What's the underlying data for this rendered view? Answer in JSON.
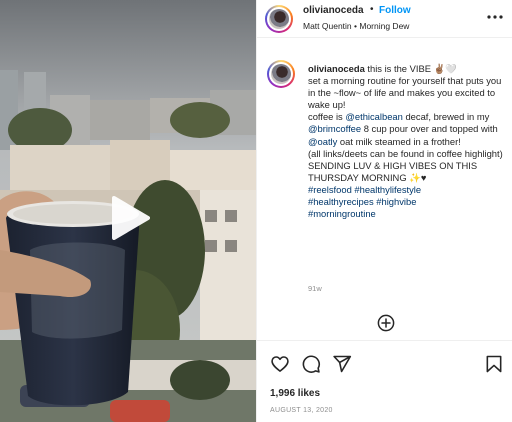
{
  "post": {
    "username": "olivianoceda",
    "separator": "•",
    "follow_label": "Follow",
    "subtitle": "Matt Quentin • Morning Dew",
    "more_icon": "more-horizontal-icon"
  },
  "caption": {
    "username": "olivianoceda",
    "intro": " this is the VIBE ✌🏽🤍",
    "line_routine": "set a morning routine for yourself that puts you in the ~flow~ of life and makes you excited to wake up!",
    "coffee_pre": "coffee is ",
    "mention_ethical": "@ethicalbean",
    "coffee_mid": " decaf, brewed in my ",
    "mention_brim": "@brimcoffee",
    "coffee_mid2": " 8 cup pour over and topped with ",
    "mention_oatly": "@oatly",
    "coffee_end": " oat milk steamed in a frother!",
    "links_note": "(all links/deets can be found in coffee highlight)",
    "sending": "SENDING LUV & HIGH VIBES ON THIS THURSDAY MORNING ✨♥",
    "tag_reelsfood": "#reelsfood",
    "tag_healthylifestyle": "#healthylifestyle",
    "tag_healthyrecipes": "#healthyrecipes",
    "tag_highvibe": "#highvibe",
    "tag_morningroutine": "#morningroutine",
    "time_ago": "91w"
  },
  "actions": {
    "like_icon": "heart-icon",
    "comment_icon": "comment-icon",
    "share_icon": "share-icon",
    "save_icon": "bookmark-icon",
    "add_comment_icon": "plus-circle-icon"
  },
  "likes": "1,996 likes",
  "date": "AUGUST 13, 2020",
  "colors": {
    "link_blue": "#0095f6",
    "mention": "#00376b",
    "muted": "#8e8e8e",
    "text": "#262626"
  }
}
